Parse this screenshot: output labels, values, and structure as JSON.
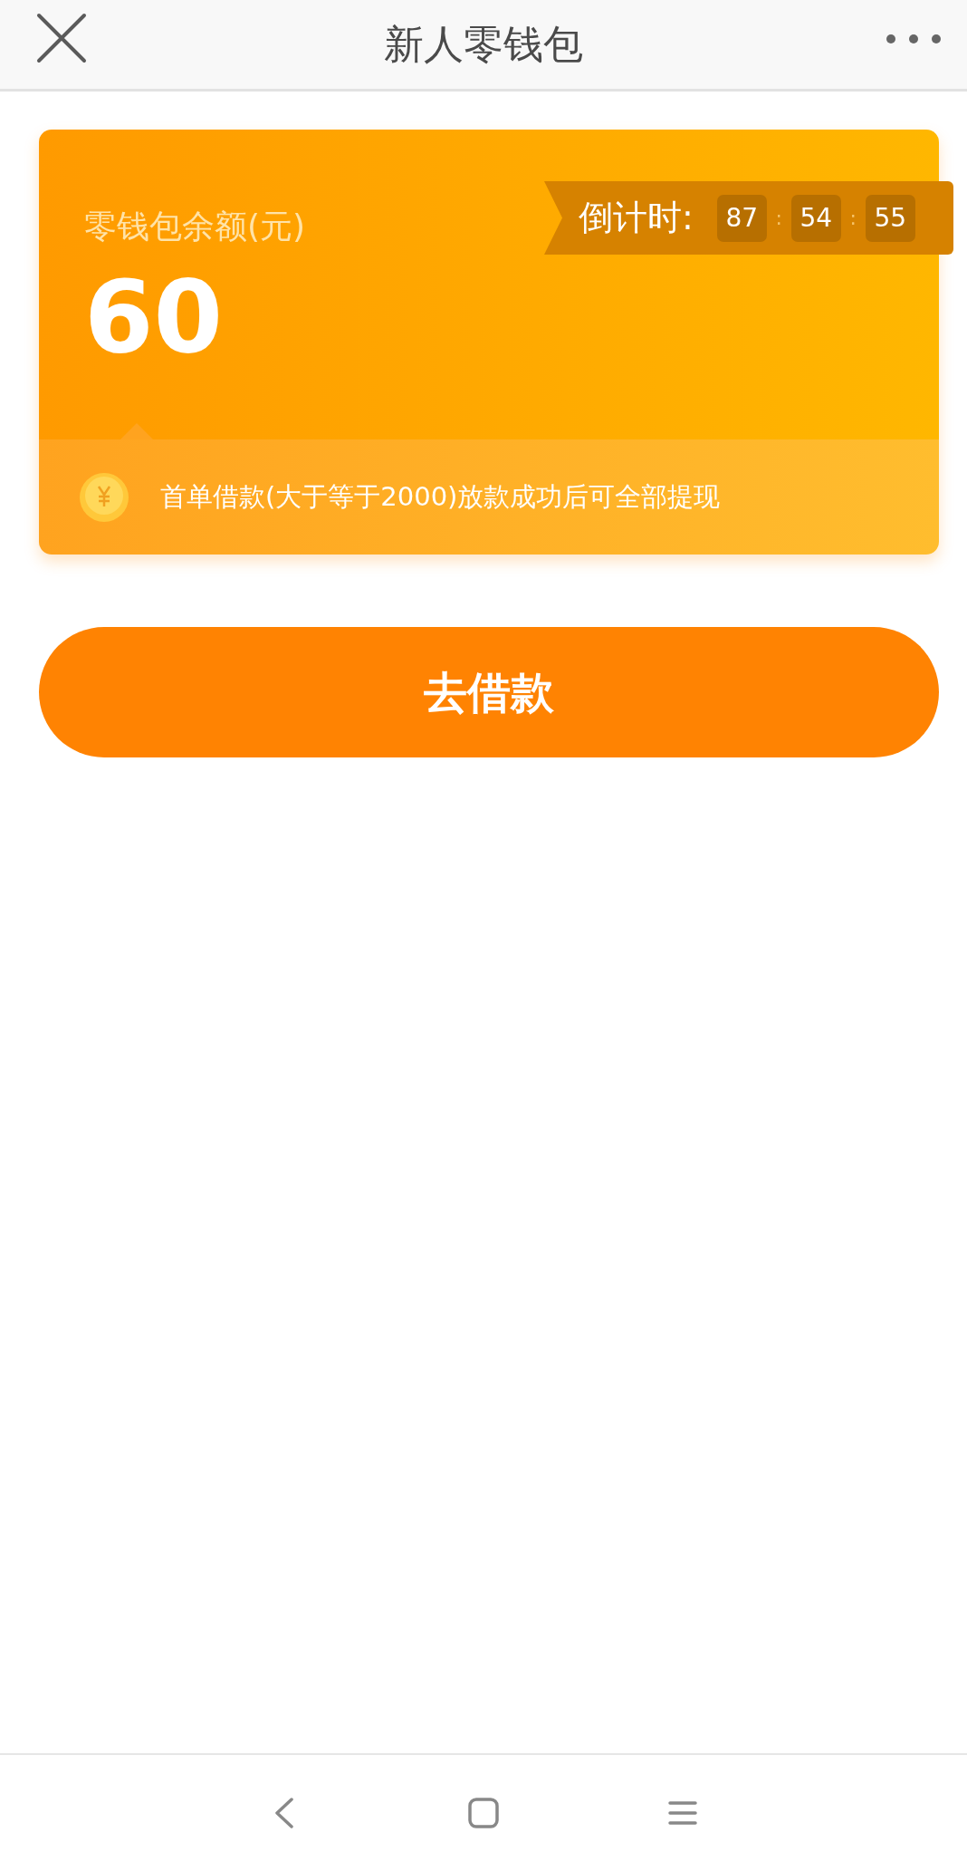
{
  "header": {
    "title": "新人零钱包"
  },
  "wallet": {
    "label": "零钱包余额(元)",
    "amount": "60",
    "countdown": {
      "label": "倒计时:",
      "segments": [
        {
          "kind": "digits",
          "text": "87"
        },
        {
          "kind": "separator",
          "text": ":"
        },
        {
          "kind": "digits",
          "text": "54"
        },
        {
          "kind": "separator",
          "text": ":"
        },
        {
          "kind": "digits",
          "text": "55"
        }
      ]
    },
    "note": "首单借款(大于等于2000)放款成功后可全部提现"
  },
  "action_button": "去借款"
}
